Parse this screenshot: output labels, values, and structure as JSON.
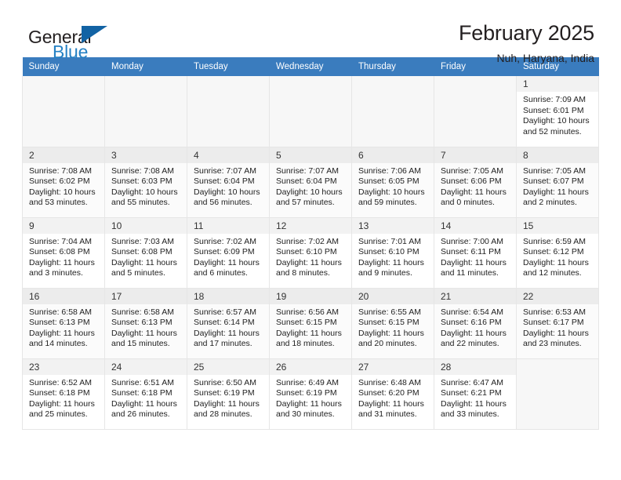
{
  "brand": {
    "name_top": "General",
    "name_bottom": "Blue",
    "accent_color": "#2581c4",
    "flag_color": "#1263a4"
  },
  "header": {
    "title": "February 2025",
    "location": "Nuh, Haryana, India"
  },
  "calendar": {
    "header_bg": "#3a7cbe",
    "weekdays": [
      "Sunday",
      "Monday",
      "Tuesday",
      "Wednesday",
      "Thursday",
      "Friday",
      "Saturday"
    ],
    "weeks": [
      [
        null,
        null,
        null,
        null,
        null,
        null,
        {
          "day": "1",
          "sunrise": "Sunrise: 7:09 AM",
          "sunset": "Sunset: 6:01 PM",
          "daylight": "Daylight: 10 hours and 52 minutes."
        }
      ],
      [
        {
          "day": "2",
          "sunrise": "Sunrise: 7:08 AM",
          "sunset": "Sunset: 6:02 PM",
          "daylight": "Daylight: 10 hours and 53 minutes."
        },
        {
          "day": "3",
          "sunrise": "Sunrise: 7:08 AM",
          "sunset": "Sunset: 6:03 PM",
          "daylight": "Daylight: 10 hours and 55 minutes."
        },
        {
          "day": "4",
          "sunrise": "Sunrise: 7:07 AM",
          "sunset": "Sunset: 6:04 PM",
          "daylight": "Daylight: 10 hours and 56 minutes."
        },
        {
          "day": "5",
          "sunrise": "Sunrise: 7:07 AM",
          "sunset": "Sunset: 6:04 PM",
          "daylight": "Daylight: 10 hours and 57 minutes."
        },
        {
          "day": "6",
          "sunrise": "Sunrise: 7:06 AM",
          "sunset": "Sunset: 6:05 PM",
          "daylight": "Daylight: 10 hours and 59 minutes."
        },
        {
          "day": "7",
          "sunrise": "Sunrise: 7:05 AM",
          "sunset": "Sunset: 6:06 PM",
          "daylight": "Daylight: 11 hours and 0 minutes."
        },
        {
          "day": "8",
          "sunrise": "Sunrise: 7:05 AM",
          "sunset": "Sunset: 6:07 PM",
          "daylight": "Daylight: 11 hours and 2 minutes."
        }
      ],
      [
        {
          "day": "9",
          "sunrise": "Sunrise: 7:04 AM",
          "sunset": "Sunset: 6:08 PM",
          "daylight": "Daylight: 11 hours and 3 minutes."
        },
        {
          "day": "10",
          "sunrise": "Sunrise: 7:03 AM",
          "sunset": "Sunset: 6:08 PM",
          "daylight": "Daylight: 11 hours and 5 minutes."
        },
        {
          "day": "11",
          "sunrise": "Sunrise: 7:02 AM",
          "sunset": "Sunset: 6:09 PM",
          "daylight": "Daylight: 11 hours and 6 minutes."
        },
        {
          "day": "12",
          "sunrise": "Sunrise: 7:02 AM",
          "sunset": "Sunset: 6:10 PM",
          "daylight": "Daylight: 11 hours and 8 minutes."
        },
        {
          "day": "13",
          "sunrise": "Sunrise: 7:01 AM",
          "sunset": "Sunset: 6:10 PM",
          "daylight": "Daylight: 11 hours and 9 minutes."
        },
        {
          "day": "14",
          "sunrise": "Sunrise: 7:00 AM",
          "sunset": "Sunset: 6:11 PM",
          "daylight": "Daylight: 11 hours and 11 minutes."
        },
        {
          "day": "15",
          "sunrise": "Sunrise: 6:59 AM",
          "sunset": "Sunset: 6:12 PM",
          "daylight": "Daylight: 11 hours and 12 minutes."
        }
      ],
      [
        {
          "day": "16",
          "sunrise": "Sunrise: 6:58 AM",
          "sunset": "Sunset: 6:13 PM",
          "daylight": "Daylight: 11 hours and 14 minutes."
        },
        {
          "day": "17",
          "sunrise": "Sunrise: 6:58 AM",
          "sunset": "Sunset: 6:13 PM",
          "daylight": "Daylight: 11 hours and 15 minutes."
        },
        {
          "day": "18",
          "sunrise": "Sunrise: 6:57 AM",
          "sunset": "Sunset: 6:14 PM",
          "daylight": "Daylight: 11 hours and 17 minutes."
        },
        {
          "day": "19",
          "sunrise": "Sunrise: 6:56 AM",
          "sunset": "Sunset: 6:15 PM",
          "daylight": "Daylight: 11 hours and 18 minutes."
        },
        {
          "day": "20",
          "sunrise": "Sunrise: 6:55 AM",
          "sunset": "Sunset: 6:15 PM",
          "daylight": "Daylight: 11 hours and 20 minutes."
        },
        {
          "day": "21",
          "sunrise": "Sunrise: 6:54 AM",
          "sunset": "Sunset: 6:16 PM",
          "daylight": "Daylight: 11 hours and 22 minutes."
        },
        {
          "day": "22",
          "sunrise": "Sunrise: 6:53 AM",
          "sunset": "Sunset: 6:17 PM",
          "daylight": "Daylight: 11 hours and 23 minutes."
        }
      ],
      [
        {
          "day": "23",
          "sunrise": "Sunrise: 6:52 AM",
          "sunset": "Sunset: 6:18 PM",
          "daylight": "Daylight: 11 hours and 25 minutes."
        },
        {
          "day": "24",
          "sunrise": "Sunrise: 6:51 AM",
          "sunset": "Sunset: 6:18 PM",
          "daylight": "Daylight: 11 hours and 26 minutes."
        },
        {
          "day": "25",
          "sunrise": "Sunrise: 6:50 AM",
          "sunset": "Sunset: 6:19 PM",
          "daylight": "Daylight: 11 hours and 28 minutes."
        },
        {
          "day": "26",
          "sunrise": "Sunrise: 6:49 AM",
          "sunset": "Sunset: 6:19 PM",
          "daylight": "Daylight: 11 hours and 30 minutes."
        },
        {
          "day": "27",
          "sunrise": "Sunrise: 6:48 AM",
          "sunset": "Sunset: 6:20 PM",
          "daylight": "Daylight: 11 hours and 31 minutes."
        },
        {
          "day": "28",
          "sunrise": "Sunrise: 6:47 AM",
          "sunset": "Sunset: 6:21 PM",
          "daylight": "Daylight: 11 hours and 33 minutes."
        },
        null
      ]
    ]
  }
}
